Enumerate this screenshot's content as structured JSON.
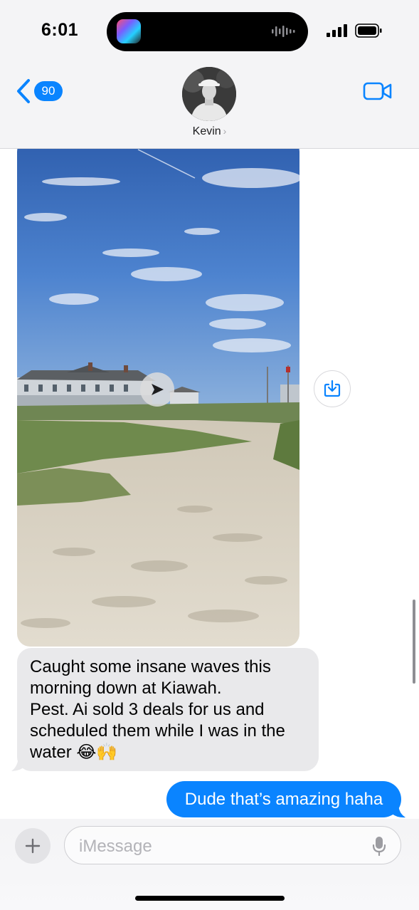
{
  "status_bar": {
    "time": "6:01",
    "signal_icon": "cellular-signal-icon",
    "battery_icon": "battery-icon"
  },
  "nav": {
    "back_badge": "90",
    "contact_name": "Kevin",
    "chevron": "›",
    "video_icon": "video-camera-icon"
  },
  "conversation": {
    "video_attachment_icon": "play-icon",
    "save_icon": "save-to-device-icon",
    "incoming_message": "Caught some insane waves this morning down at Kiawah.\nPest. Ai sold 3 deals for us and scheduled them while I was in the water 😂🙌",
    "outgoing_message": "Dude that’s amazing haha"
  },
  "input": {
    "placeholder": "iMessage",
    "value": "",
    "plus_icon": "plus-icon",
    "mic_icon": "microphone-icon"
  },
  "colors": {
    "accent": "#0a84ff",
    "incoming_bubble": "#e9e9eb",
    "header_bg": "#f4f4f6"
  }
}
